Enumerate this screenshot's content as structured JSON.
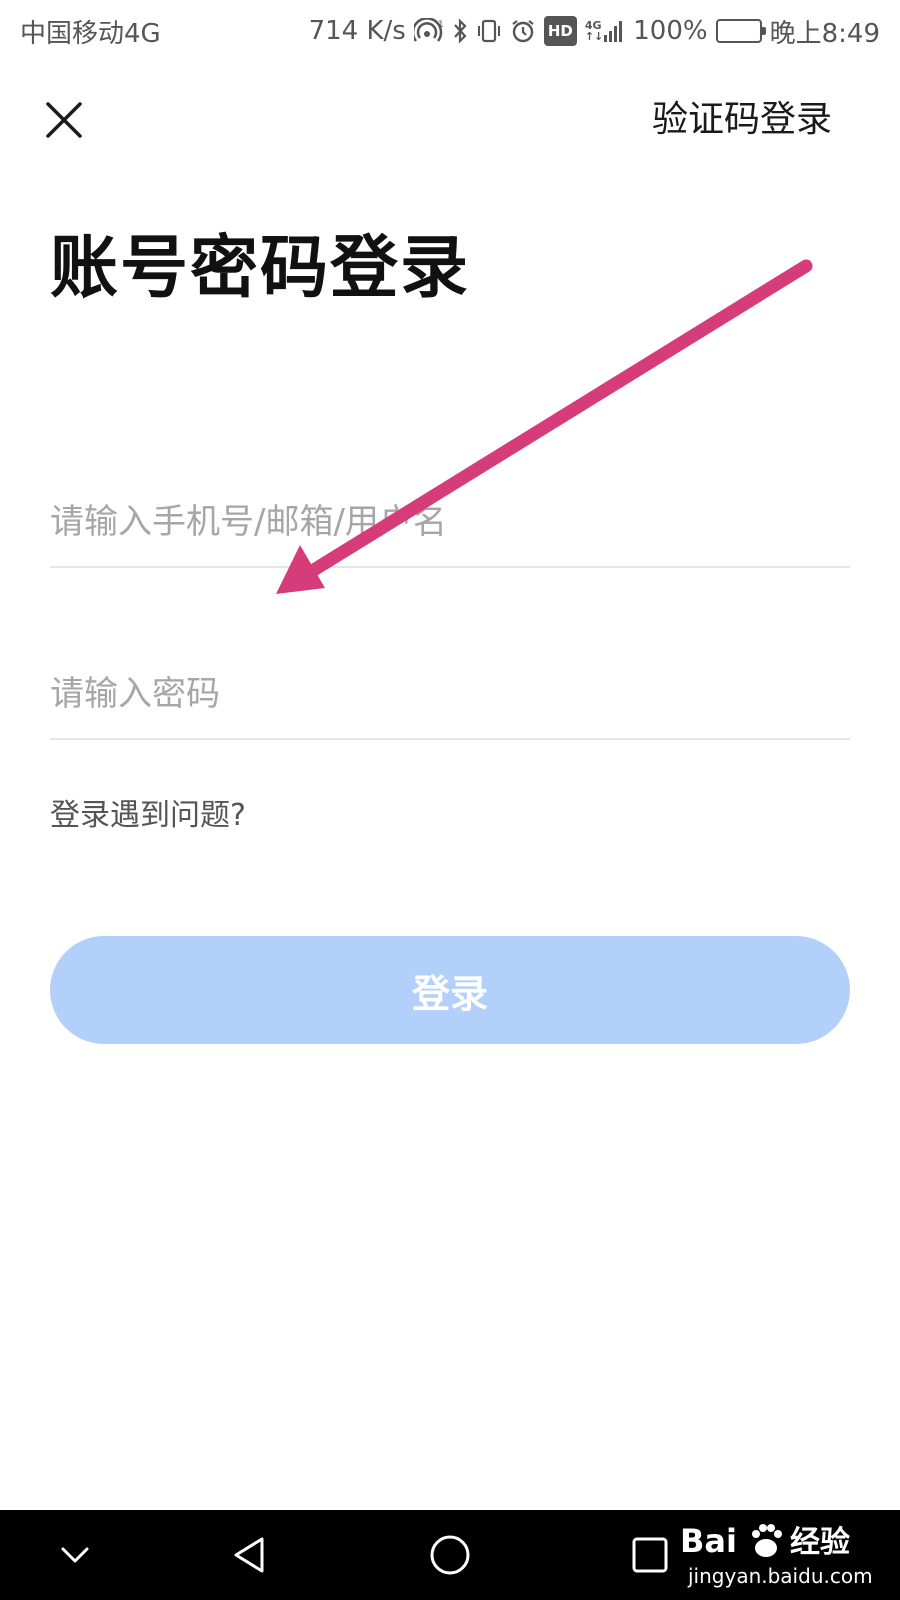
{
  "status_bar": {
    "carrier": "中国移动4G",
    "speed": "714 K/s",
    "hd_badge": "HD",
    "network_top": "4G",
    "network_bottom": "↑↓",
    "battery": "100%",
    "time": "晚上8:49",
    "battery_level": 1.0
  },
  "header": {
    "close_icon": "close-icon",
    "sms_login_label": "验证码登录"
  },
  "title": "账号密码登录",
  "form": {
    "account_placeholder": "请输入手机号/邮箱/用户名",
    "account_value": "",
    "password_placeholder": "请输入密码",
    "password_value": "",
    "help_label": "登录遇到问题?",
    "login_label": "登录"
  },
  "colors": {
    "login_button": "#b3d0fa",
    "annotation_arrow": "#d63b7a",
    "nav_bar": "#000000"
  },
  "annotation": {
    "arrow_icon": "arrow-annotation"
  },
  "nav_bar": {
    "icons": [
      "chevron-down-icon",
      "back-triangle-icon",
      "home-circle-icon",
      "recents-square-icon"
    ]
  },
  "watermark": {
    "logo_text": "Bai",
    "logo_text_2": "经验",
    "url": "jingyan.baidu.com"
  }
}
